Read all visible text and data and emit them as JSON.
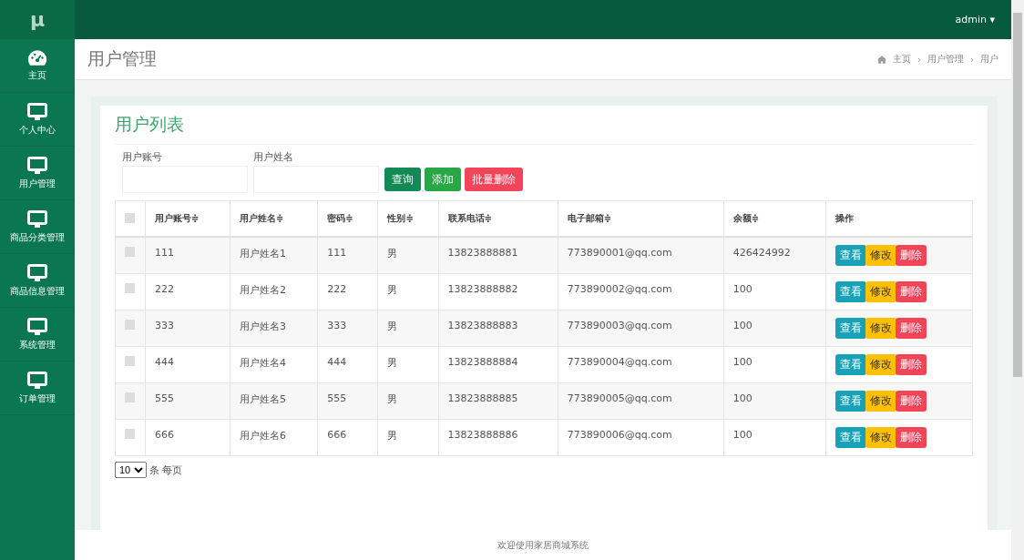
{
  "logo": "μ",
  "user_menu": {
    "label": "admin",
    "caret": "▾"
  },
  "sidebar": {
    "items": [
      {
        "label": "主页",
        "kind": "dashboard",
        "selected": false
      },
      {
        "label": "个人中心",
        "kind": "monitor",
        "selected": false
      },
      {
        "label": "用户管理",
        "kind": "monitor",
        "selected": false
      },
      {
        "label": "商品分类管理",
        "kind": "monitor",
        "selected": false
      },
      {
        "label": "商品信息管理",
        "kind": "monitor",
        "selected": false
      },
      {
        "label": "系统管理",
        "kind": "monitor",
        "selected": false
      },
      {
        "label": "订单管理",
        "kind": "monitor",
        "selected": false
      }
    ]
  },
  "page_title": "用户管理",
  "breadcrumb": [
    "主页",
    "›",
    "用户管理",
    "›",
    "用户"
  ],
  "card": {
    "title": "用户列表",
    "filters": [
      {
        "label": "用户账号"
      },
      {
        "label": "用户姓名"
      }
    ],
    "buttons": [
      {
        "label": "查询",
        "kind": "search"
      },
      {
        "label": "添加",
        "kind": "add"
      },
      {
        "label": "批量删除",
        "kind": "danger"
      }
    ],
    "table": {
      "all_checked": false,
      "columns": [
        "用户账号",
        "用户姓名",
        "密码",
        "性别",
        "联系电话",
        "电子邮箱",
        "余额"
      ],
      "sort_mark": "≑",
      "action_column": "操作",
      "rows": [
        {
          "checked": false,
          "cells": [
            "111",
            "用户姓名1",
            "111",
            "男",
            "13823888881",
            "773890001@qq.com",
            "426424992"
          ],
          "actions": [
            {
              "label": "查看",
              "kind": "view"
            },
            {
              "label": "修改",
              "kind": "edit"
            },
            {
              "label": "删除",
              "kind": "delete"
            }
          ]
        },
        {
          "checked": false,
          "cells": [
            "222",
            "用户姓名2",
            "222",
            "男",
            "13823888882",
            "773890002@qq.com",
            "100"
          ],
          "actions": [
            {
              "label": "查看",
              "kind": "view"
            },
            {
              "label": "修改",
              "kind": "edit"
            },
            {
              "label": "删除",
              "kind": "delete"
            }
          ]
        },
        {
          "checked": false,
          "cells": [
            "333",
            "用户姓名3",
            "333",
            "男",
            "13823888883",
            "773890003@qq.com",
            "100"
          ],
          "actions": [
            {
              "label": "查看",
              "kind": "view"
            },
            {
              "label": "修改",
              "kind": "edit"
            },
            {
              "label": "删除",
              "kind": "delete"
            }
          ]
        },
        {
          "checked": false,
          "cells": [
            "444",
            "用户姓名4",
            "444",
            "男",
            "13823888884",
            "773890004@qq.com",
            "100"
          ],
          "actions": [
            {
              "label": "查看",
              "kind": "view"
            },
            {
              "label": "修改",
              "kind": "edit"
            },
            {
              "label": "删除",
              "kind": "delete"
            }
          ]
        },
        {
          "checked": false,
          "cells": [
            "555",
            "用户姓名5",
            "555",
            "男",
            "13823888885",
            "773890005@qq.com",
            "100"
          ],
          "actions": [
            {
              "label": "查看",
              "kind": "view"
            },
            {
              "label": "修改",
              "kind": "edit"
            },
            {
              "label": "删除",
              "kind": "delete"
            }
          ]
        },
        {
          "checked": false,
          "cells": [
            "666",
            "用户姓名6",
            "666",
            "男",
            "13823888886",
            "773890006@qq.com",
            "100"
          ],
          "actions": [
            {
              "label": "查看",
              "kind": "view"
            },
            {
              "label": "修改",
              "kind": "edit"
            },
            {
              "label": "删除",
              "kind": "delete"
            }
          ]
        }
      ]
    },
    "page_size": {
      "value": "10",
      "suffix": "条 每页"
    }
  },
  "footer": "欢迎使用家居商城系统"
}
